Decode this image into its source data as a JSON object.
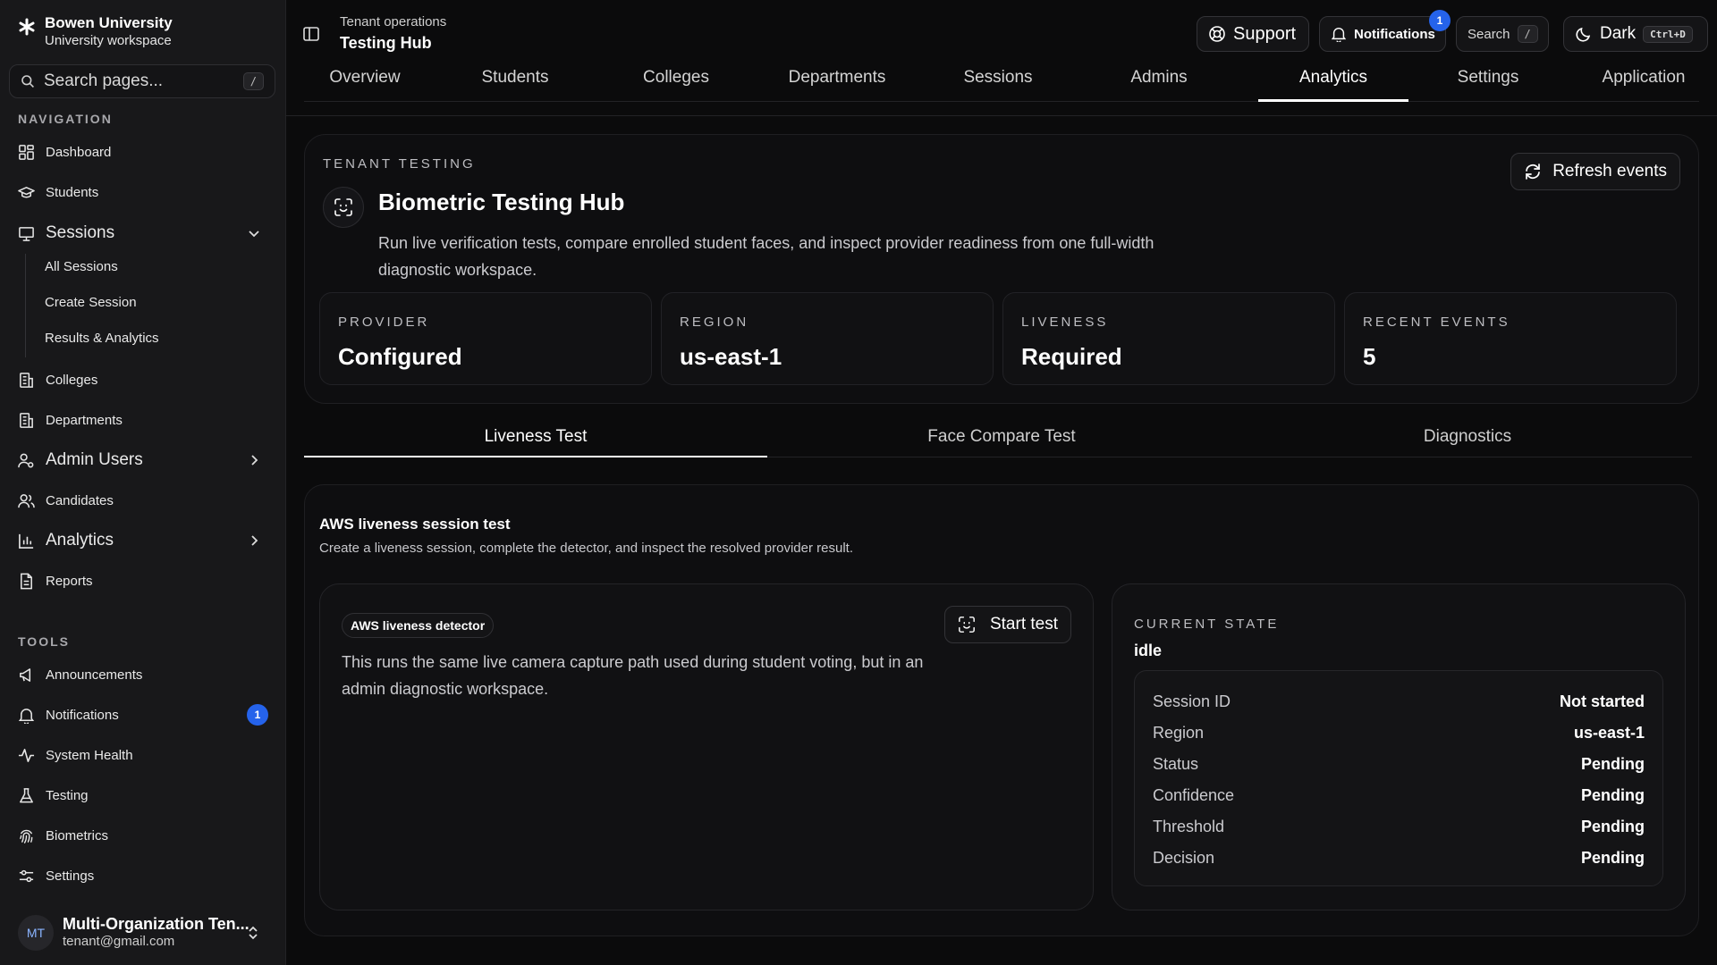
{
  "brand": {
    "name": "Bowen University",
    "subtitle": "University workspace",
    "icon": "asterisk-icon"
  },
  "sidebar": {
    "search_placeholder": "Search pages...",
    "search_shortcut": "/",
    "navigation_label": "NAVIGATION",
    "nav": [
      {
        "label": "Dashboard",
        "icon": "grid-icon"
      },
      {
        "label": "Students",
        "icon": "graduation-cap-icon"
      },
      {
        "label": "Sessions",
        "icon": "presentation-icon",
        "expanded": true
      },
      {
        "label": "Colleges",
        "icon": "building-icon"
      },
      {
        "label": "Departments",
        "icon": "building-icon"
      },
      {
        "label": "Admin Users",
        "icon": "user-cog-icon",
        "expanded": false
      },
      {
        "label": "Candidates",
        "icon": "users-icon"
      },
      {
        "label": "Analytics",
        "icon": "bar-chart-icon",
        "expanded": false
      },
      {
        "label": "Reports",
        "icon": "file-text-icon"
      }
    ],
    "sessions_sub": [
      "All Sessions",
      "Create Session",
      "Results & Analytics"
    ],
    "tools_label": "TOOLS",
    "tools": [
      {
        "label": "Announcements",
        "icon": "megaphone-icon"
      },
      {
        "label": "Notifications",
        "icon": "bell-icon",
        "badge": "1"
      },
      {
        "label": "System Health",
        "icon": "activity-icon"
      },
      {
        "label": "Testing",
        "icon": "flask-icon"
      },
      {
        "label": "Biometrics",
        "icon": "fingerprint-icon"
      },
      {
        "label": "Settings",
        "icon": "sliders-icon"
      }
    ],
    "user": {
      "initials": "MT",
      "name": "Multi-Organization Ten...",
      "email": "tenant@gmail.com"
    }
  },
  "header": {
    "breadcrumb_parent": "Tenant operations",
    "breadcrumb_current": "Testing Hub",
    "support_label": "Support",
    "notifications_label": "Notifications",
    "notifications_count": "1",
    "search_label": "Search",
    "search_shortcut": "/",
    "theme_label": "Dark",
    "theme_shortcut": "Ctrl+D",
    "tabs": [
      "Overview",
      "Students",
      "Colleges",
      "Departments",
      "Sessions",
      "Admins",
      "Analytics",
      "Settings",
      "Application"
    ],
    "active_tab": "Analytics"
  },
  "hub": {
    "eyebrow": "TENANT TESTING",
    "title": "Biometric Testing Hub",
    "description": "Run live verification tests, compare enrolled student faces, and inspect provider readiness from one full-width diagnostic workspace.",
    "refresh_label": "Refresh events",
    "stats": [
      {
        "label": "PROVIDER",
        "value": "Configured"
      },
      {
        "label": "REGION",
        "value": "us-east-1"
      },
      {
        "label": "LIVENESS",
        "value": "Required"
      },
      {
        "label": "RECENT EVENTS",
        "value": "5"
      }
    ]
  },
  "subtabs": [
    "Liveness Test",
    "Face Compare Test",
    "Diagnostics"
  ],
  "active_subtab": "Liveness Test",
  "liveness": {
    "title": "AWS liveness session test",
    "description": "Create a liveness session, complete the detector, and inspect the resolved provider result.",
    "detector_pill": "AWS liveness detector",
    "detector_text": "This runs the same live camera capture path used during student voting, but in an admin diagnostic workspace.",
    "start_label": "Start test",
    "state_label": "CURRENT STATE",
    "state_value": "idle",
    "details": [
      {
        "key": "Session ID",
        "value": "Not started"
      },
      {
        "key": "Region",
        "value": "us-east-1"
      },
      {
        "key": "Status",
        "value": "Pending"
      },
      {
        "key": "Confidence",
        "value": "Pending"
      },
      {
        "key": "Threshold",
        "value": "Pending"
      },
      {
        "key": "Decision",
        "value": "Pending"
      }
    ]
  },
  "colors": {
    "accent": "#2563eb",
    "background": "#0b0b0c",
    "sidebar": "#18181a"
  }
}
